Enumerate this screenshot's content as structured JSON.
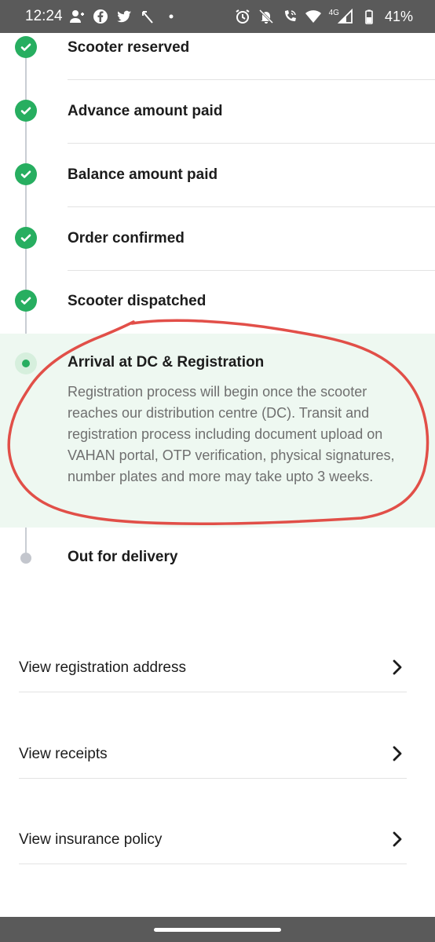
{
  "status_bar": {
    "time": "12:24",
    "battery_percent": "41%",
    "network": "4G",
    "left_icons": [
      "person-add-icon",
      "facebook-icon",
      "twitter-icon",
      "missed-call-icon",
      "dot-icon"
    ],
    "right_icons": [
      "alarm-icon",
      "notifications-off-icon",
      "wifi-calling-icon",
      "wifi-icon",
      "signal-icon",
      "battery-icon"
    ]
  },
  "timeline": {
    "completed_steps": [
      {
        "label": "Scooter reserved"
      },
      {
        "label": "Advance amount paid"
      },
      {
        "label": "Balance amount paid"
      },
      {
        "label": "Order confirmed"
      },
      {
        "label": "Scooter dispatched"
      }
    ],
    "active_step": {
      "label": "Arrival at DC & Registration",
      "description": "Registration process will begin once the scooter reaches our distribution centre (DC). Transit and registration process including document upload on VAHAN portal, OTP verification, physical signatures, number plates and more may take upto 3 weeks."
    },
    "pending_step": {
      "label": "Out for delivery"
    }
  },
  "links": [
    {
      "label": "View registration address",
      "icon": "chevron-right-icon"
    },
    {
      "label": "View receipts",
      "icon": "chevron-right-icon"
    },
    {
      "label": "View insurance policy",
      "icon": "chevron-right-icon"
    }
  ],
  "colors": {
    "completed": "#27ae60",
    "active_background": "#eef8f1",
    "pending": "#c3c6cd",
    "annotation": "#e0403a"
  }
}
